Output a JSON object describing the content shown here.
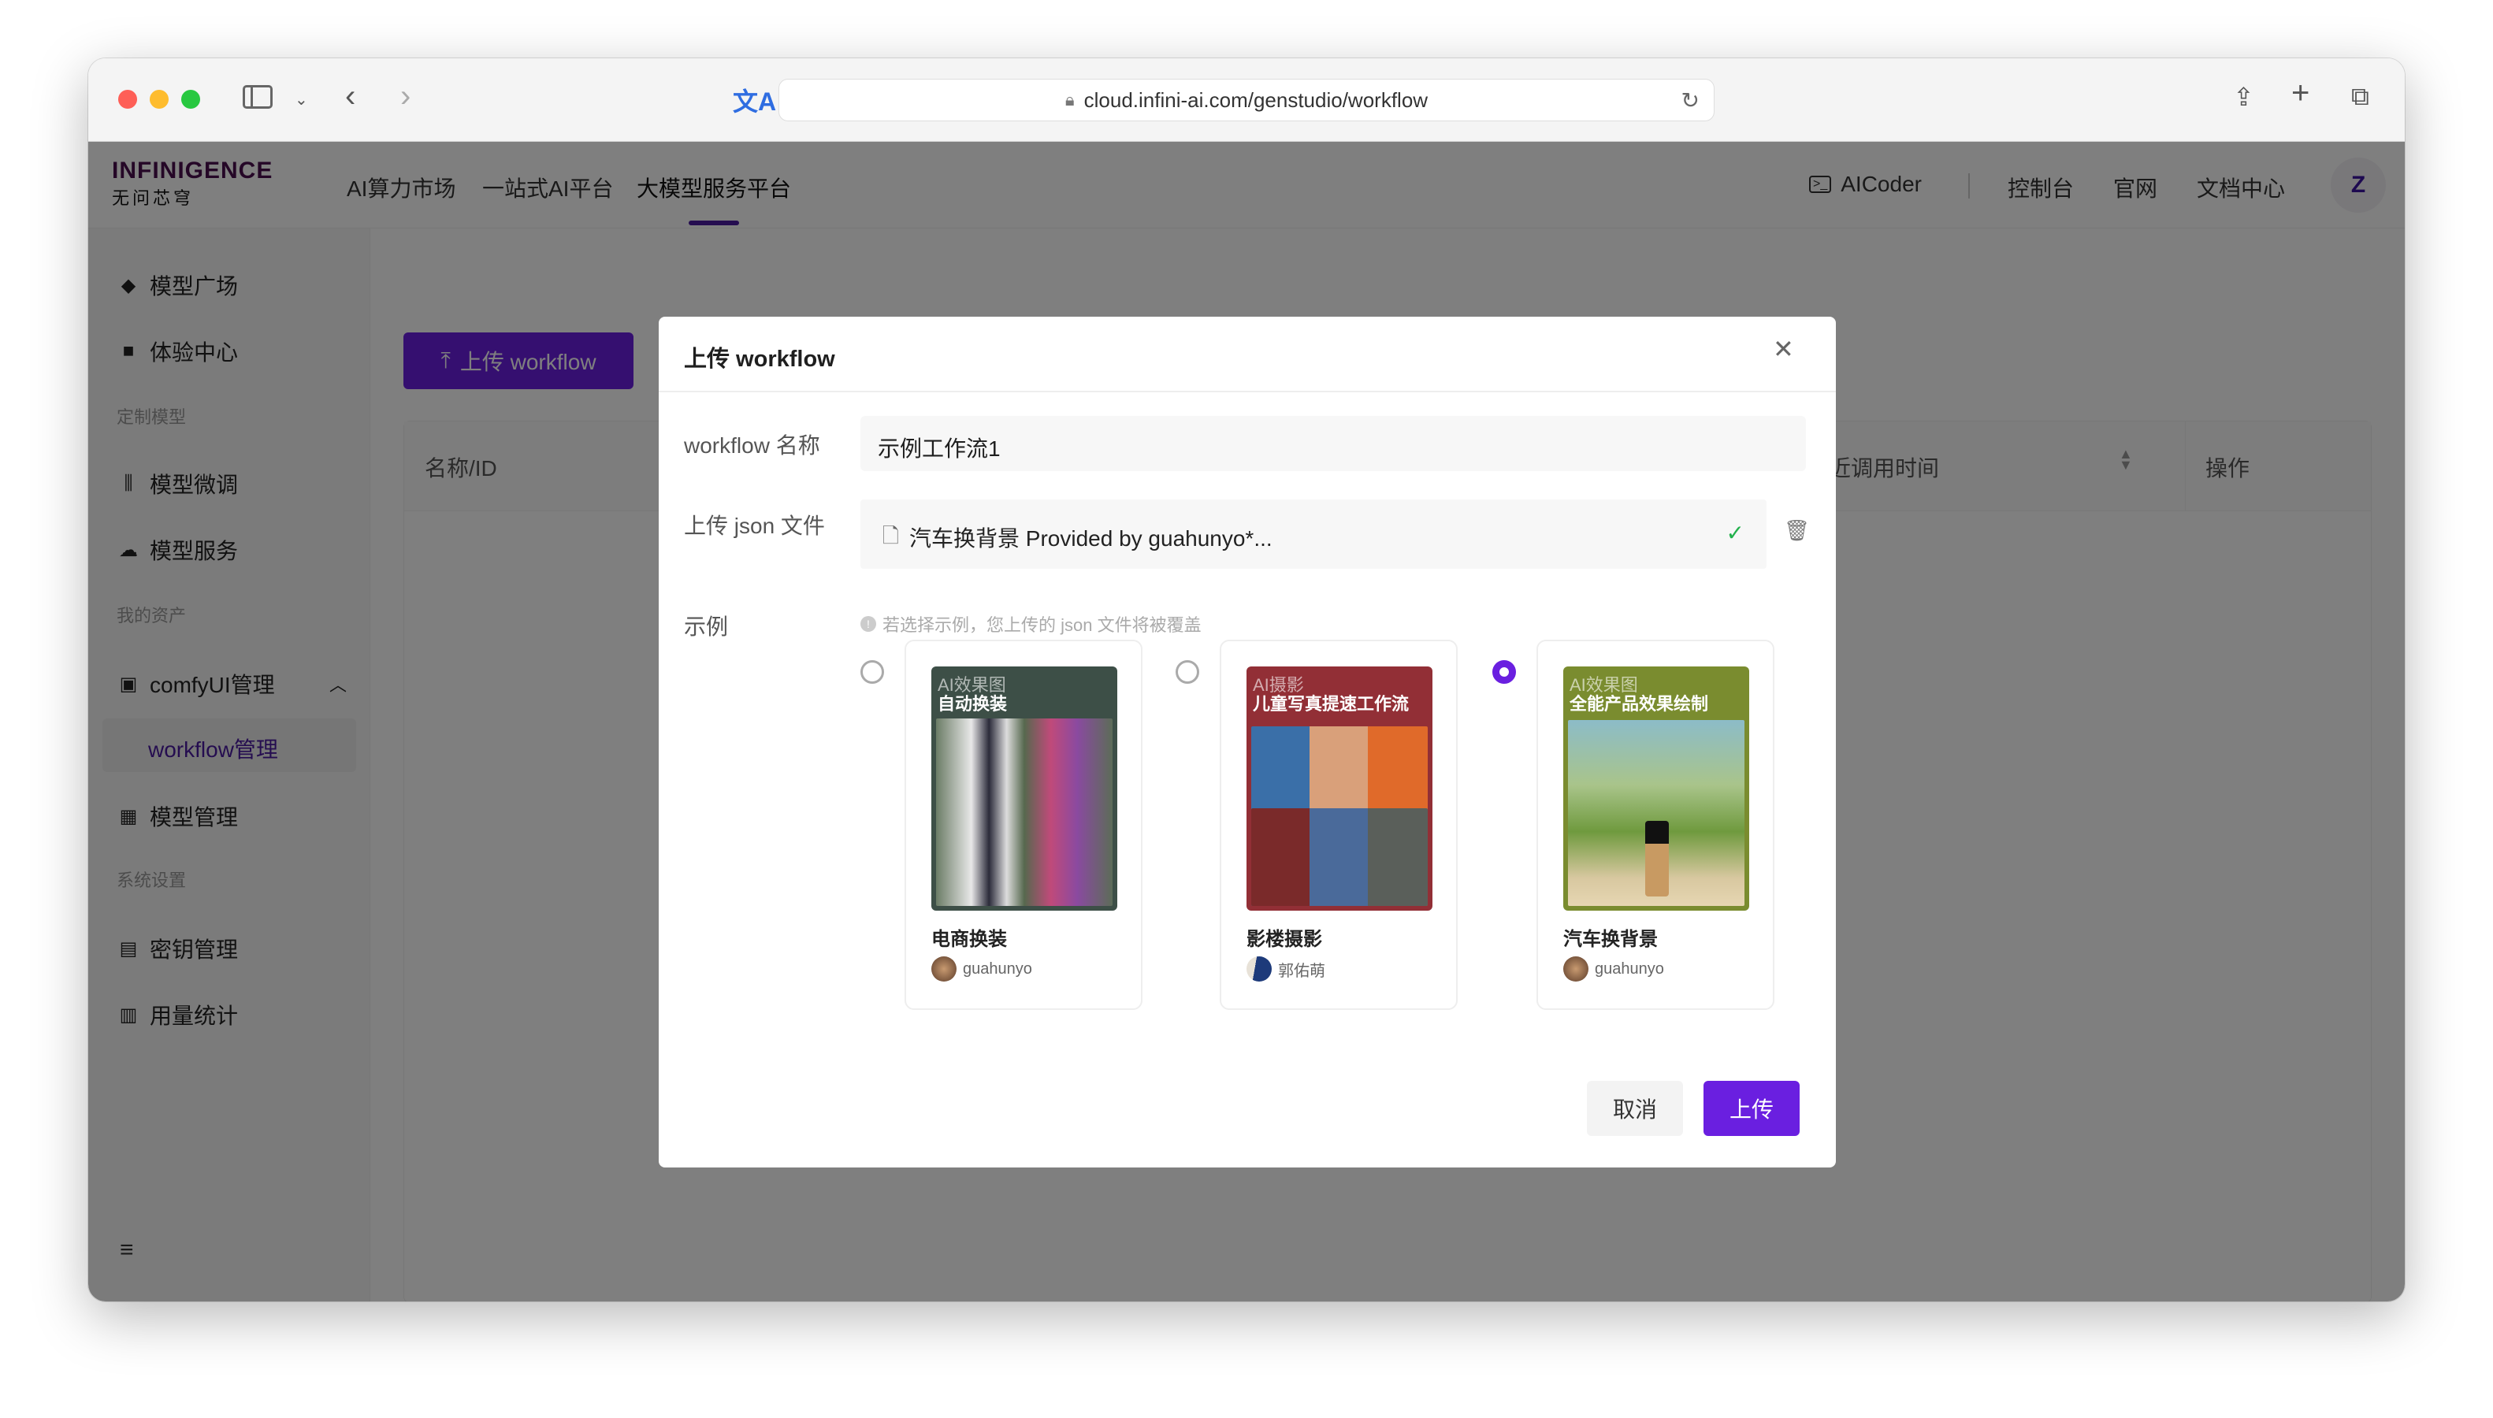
{
  "browser": {
    "url": "cloud.infini-ai.com/genstudio/workflow",
    "icons": [
      "sidebar-icon",
      "chevron-down-icon",
      "back-icon",
      "forward-icon",
      "translate-icon",
      "lock-icon",
      "reload-icon",
      "share-icon",
      "new-tab-icon",
      "tabs-icon"
    ]
  },
  "header": {
    "logo_text": "INFINIGENCE",
    "logo_subtext": "无问芯穹",
    "nav": [
      "AI算力市场",
      "一站式AI平台",
      "大模型服务平台"
    ],
    "active_nav": "大模型服务平台",
    "right": {
      "aicoder": "AICoder",
      "console": "控制台",
      "official": "官网",
      "docs": "文档中心",
      "avatar": "Z"
    }
  },
  "sidebar": {
    "items": [
      {
        "type": "item",
        "label": "模型广场",
        "icon": "cube-icon"
      },
      {
        "type": "item",
        "label": "体验中心",
        "icon": "square-icon"
      },
      {
        "type": "section",
        "label": "定制模型"
      },
      {
        "type": "item",
        "label": "模型微调",
        "icon": "sliders-icon"
      },
      {
        "type": "item",
        "label": "模型服务",
        "icon": "cloud-icon"
      },
      {
        "type": "section",
        "label": "我的资产"
      },
      {
        "type": "item",
        "label": "comfyUI管理",
        "icon": "app-icon",
        "expanded": true
      },
      {
        "type": "sub",
        "label": "workflow管理",
        "selected": true
      },
      {
        "type": "item",
        "label": "模型管理",
        "icon": "grid-icon"
      },
      {
        "type": "section",
        "label": "系统设置"
      },
      {
        "type": "item",
        "label": "密钥管理",
        "icon": "key-icon"
      },
      {
        "type": "item",
        "label": "用量统计",
        "icon": "bar-chart-icon"
      }
    ]
  },
  "main": {
    "upload_button": "上传 workflow",
    "table": {
      "columns": [
        "名称/ID",
        "最近调用时间",
        "操作"
      ]
    }
  },
  "modal": {
    "title": "上传 workflow",
    "name_label": "workflow 名称",
    "name_value": "示例工作流1",
    "file_label": "上传 json 文件",
    "file_name": "汽车换背景 Provided by guahunyo*...",
    "example_label": "示例",
    "hint": "若选择示例，您上传的 json 文件将被覆盖",
    "examples": [
      {
        "tag": "AI效果图",
        "subtitle": "自动换装",
        "title": "电商换装",
        "author": "guahunyo",
        "selected": false,
        "color": "#3d4f47"
      },
      {
        "tag": "AI摄影",
        "subtitle": "儿童写真提速工作流",
        "title": "影楼摄影",
        "author": "郭佑萌",
        "selected": false,
        "color": "#922f36"
      },
      {
        "tag": "AI效果图",
        "subtitle": "全能产品效果绘制",
        "title": "汽车换背景",
        "author": "guahunyo",
        "selected": true,
        "color": "#7a8c2f"
      }
    ],
    "cancel": "取消",
    "submit": "上传"
  },
  "colors": {
    "accent": "#6a1fe0",
    "success": "#22b14c"
  }
}
